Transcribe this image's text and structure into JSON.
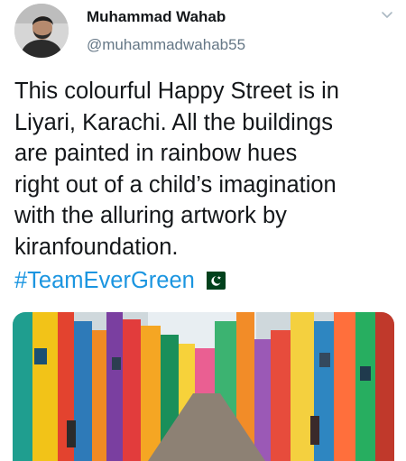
{
  "user": {
    "display_name": "Muhammad Wahab",
    "handle": "@muhammadwahab55",
    "avatar_icon": "profile-photo"
  },
  "menu": {
    "icon": "chevron-down-icon"
  },
  "tweet": {
    "text": "This colourful Happy Street is in\nLiyari, Karachi. All the buildings\nare painted in rainbow hues\nright out of a child’s imagination\nwith the alluring artwork by\nkiranfoundation.",
    "hashtag": "#TeamEverGreen",
    "flag_icon": "pakistan-flag-emoji"
  },
  "media": {
    "icon": "street-photo"
  },
  "colors": {
    "text": "#14171a",
    "secondary": "#657786",
    "link": "#1b95e0",
    "flag_green": "#01411c"
  }
}
